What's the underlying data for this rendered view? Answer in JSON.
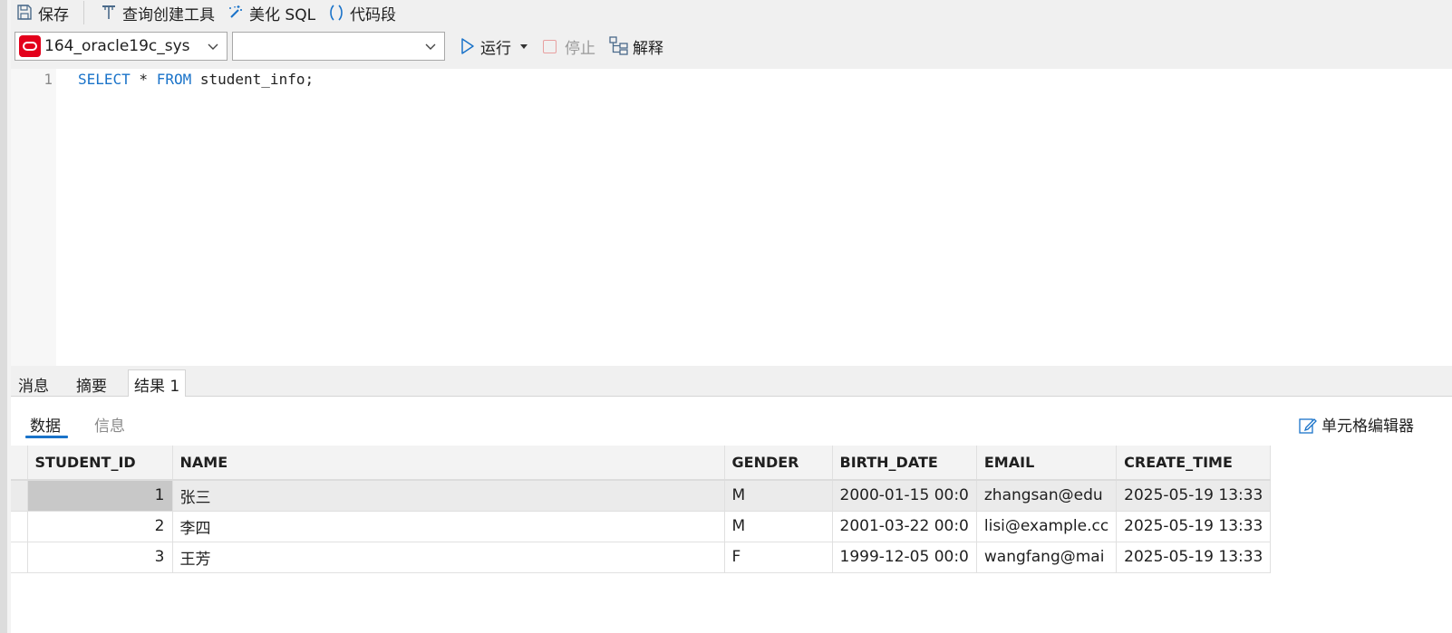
{
  "toolbar": {
    "save": "保存",
    "query_builder": "查询创建工具",
    "beautify": "美化 SQL",
    "snippet": "代码段"
  },
  "connection": {
    "name": "164_oracle19c_sys",
    "database": ""
  },
  "actions": {
    "run": "运行",
    "stop": "停止",
    "explain": "解释"
  },
  "editor": {
    "line_number": "1",
    "tokens": {
      "kw1": "SELECT",
      "star": " * ",
      "kw2": "FROM",
      "rest": " student_info;"
    }
  },
  "result_tabs": [
    "消息",
    "摘要",
    "结果 1"
  ],
  "sub_tabs": {
    "data": "数据",
    "info": "信息",
    "cell_editor": "单元格编辑器"
  },
  "grid": {
    "columns": [
      "STUDENT_ID",
      "NAME",
      "GENDER",
      "BIRTH_DATE",
      "EMAIL",
      "CREATE_TIME"
    ],
    "rows": [
      [
        "1",
        "张三",
        "M",
        "2000-01-15 00:0",
        "zhangsan@edu",
        "2025-05-19 13:33"
      ],
      [
        "2",
        "李四",
        "M",
        "2001-03-22 00:0",
        "lisi@example.cc",
        "2025-05-19 13:33"
      ],
      [
        "3",
        "王芳",
        "F",
        "1999-12-05 00:0",
        "wangfang@mai",
        "2025-05-19 13:33"
      ]
    ]
  },
  "colors": {
    "accent": "#1a73c9",
    "oracle": "#e3001b",
    "keyword": "#1a73c9"
  },
  "icons": {
    "save": "save-icon",
    "query_builder": "query-builder-icon",
    "beautify": "magic-wand-icon",
    "snippet": "code-snippet-icon",
    "run": "play-icon",
    "stop": "stop-icon",
    "explain": "explain-icon",
    "cell_editor": "edit-icon",
    "oracle": "oracle-icon"
  }
}
